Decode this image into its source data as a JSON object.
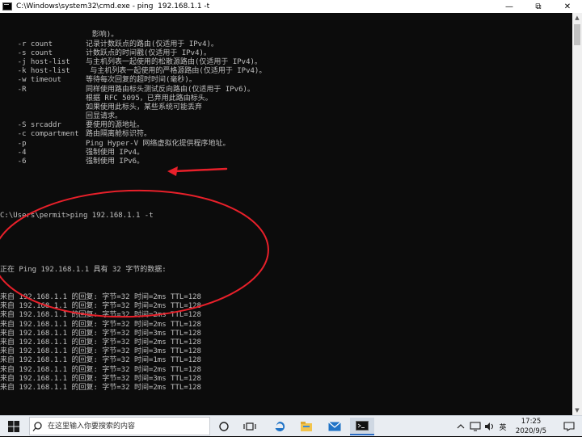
{
  "window": {
    "title": "C:\\Windows\\system32\\cmd.exe - ping  192.168.1.1 -t",
    "controls": {
      "minimize": "—",
      "maximize": "⧉",
      "close": "✕"
    }
  },
  "console": {
    "help_lines": [
      {
        "opt": "",
        "desc": "                     影响)。"
      },
      {
        "opt": "    -r count",
        "desc": "记录计数跃点的路由(仅适用于 IPv4)。"
      },
      {
        "opt": "    -s count",
        "desc": "计数跃点的时间戳(仅适用于 IPv4)。"
      },
      {
        "opt": "    -j host-list",
        "desc": "与主机列表一起使用的松散源路由(仅适用于 IPv4)。"
      },
      {
        "opt": "    -k host-list",
        "desc": " 与主机列表一起使用的严格源路由(仅适用于 IPv4)。"
      },
      {
        "opt": "    -w timeout",
        "desc": "等待每次回复的超时时间(毫秒)。"
      },
      {
        "opt": "    -R",
        "desc": "同样使用路由标头测试反向路由(仅适用于 IPv6)。"
      },
      {
        "opt": "",
        "desc": "根据 RFC 5095，已弃用此路由标头。"
      },
      {
        "opt": "",
        "desc": "如果使用此标头，某些系统可能丢弃"
      },
      {
        "opt": "",
        "desc": "回显请求。"
      },
      {
        "opt": "    -S srcaddr",
        "desc": "要使用的源地址。"
      },
      {
        "opt": "    -c compartment",
        "desc": "路由隔离舱标识符。"
      },
      {
        "opt": "    -p",
        "desc": "Ping Hyper-V 网络虚拟化提供程序地址。"
      },
      {
        "opt": "    -4",
        "desc": "强制使用 IPv4。"
      },
      {
        "opt": "    -6",
        "desc": "强制使用 IPv6。"
      }
    ],
    "prompt": "C:\\Users\\permit>ping 192.168.1.1 -t",
    "pinging": "正在 Ping 192.168.1.1 具有 32 字节的数据:",
    "replies": [
      "来自 192.168.1.1 的回复: 字节=32 时间=2ms TTL=128",
      "来自 192.168.1.1 的回复: 字节=32 时间=2ms TTL=128",
      "来自 192.168.1.1 的回复: 字节=32 时间=2ms TTL=128",
      "来自 192.168.1.1 的回复: 字节=32 时间=2ms TTL=128",
      "来自 192.168.1.1 的回复: 字节=32 时间=3ms TTL=128",
      "来自 192.168.1.1 的回复: 字节=32 时间=2ms TTL=128",
      "来自 192.168.1.1 的回复: 字节=32 时间=3ms TTL=128",
      "来自 192.168.1.1 的回复: 字节=32 时间=1ms TTL=128",
      "来自 192.168.1.1 的回复: 字节=32 时间=2ms TTL=128",
      "来自 192.168.1.1 的回复: 字节=32 时间=3ms TTL=128",
      "来自 192.168.1.1 的回复: 字节=32 时间=2ms TTL=128"
    ],
    "colors": {
      "background": "#0c0c0c",
      "text": "#c0c0c0",
      "annotation": "#e8202a"
    }
  },
  "taskbar": {
    "search_placeholder": "在这里输入你要搜索的内容",
    "tray_ime": "英",
    "time": "17:25",
    "date": "2020/9/5",
    "icons": [
      "windows-start-icon",
      "search-icon",
      "cortana-icon",
      "task-view-icon",
      "edge-icon",
      "file-explorer-icon",
      "mail-icon",
      "cmd-icon",
      "chevron-up-icon",
      "network-icon",
      "volume-icon",
      "notification-icon"
    ]
  }
}
